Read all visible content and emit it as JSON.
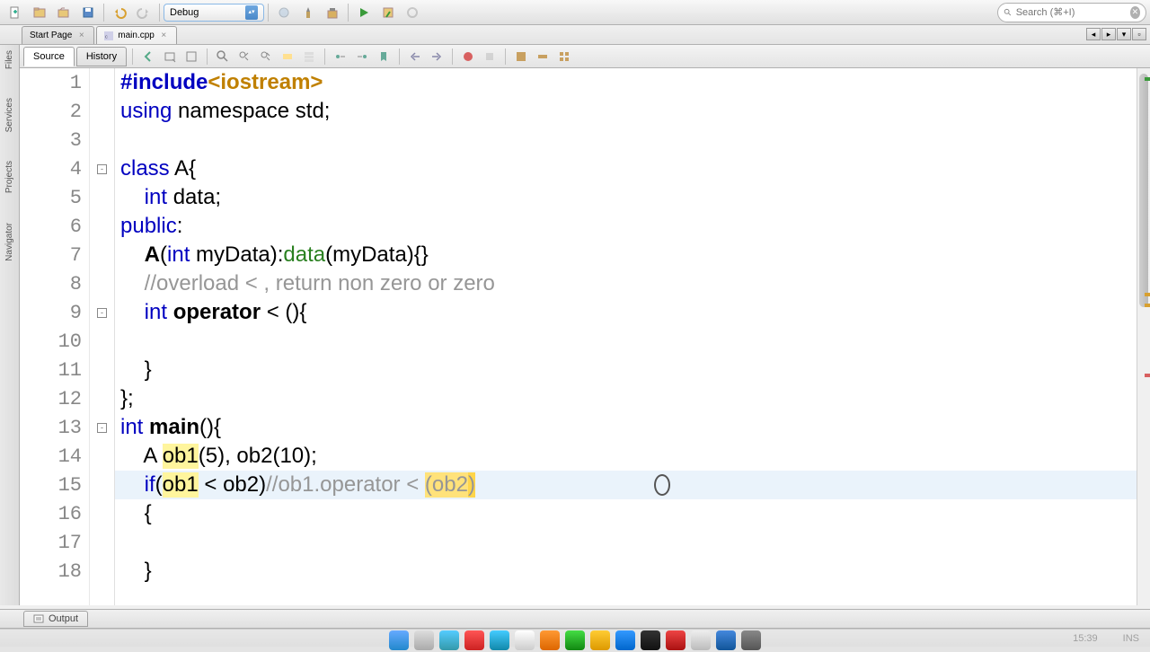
{
  "toolbar": {
    "config": "Debug",
    "search_placeholder": "Search (⌘+I)"
  },
  "tabs": {
    "start": "Start Page",
    "main": "main.cpp"
  },
  "editor_tabs": {
    "source": "Source",
    "history": "History"
  },
  "rail": {
    "files": "Files",
    "services": "Services",
    "projects": "Projects",
    "navigator": "Navigator"
  },
  "code": {
    "lines": [
      {
        "n": 1
      },
      {
        "n": 2
      },
      {
        "n": 3
      },
      {
        "n": 4,
        "fold": "-"
      },
      {
        "n": 5
      },
      {
        "n": 6
      },
      {
        "n": 7
      },
      {
        "n": 8
      },
      {
        "n": 9,
        "fold": "-"
      },
      {
        "n": 10
      },
      {
        "n": 11
      },
      {
        "n": 12
      },
      {
        "n": 13,
        "fold": "-"
      },
      {
        "n": 14
      },
      {
        "n": 15
      },
      {
        "n": 16
      },
      {
        "n": 17
      },
      {
        "n": 18
      }
    ],
    "l1_a": "#include",
    "l1_b": "<iostream>",
    "l2_a": "using",
    "l2_b": " namespace std;",
    "l4_a": "class",
    "l4_b": " A{",
    "l5_a": "    ",
    "l5_b": "int",
    "l5_c": " data;",
    "l6_a": "public",
    "l6_b": ":",
    "l7_a": "    ",
    "l7_b": "A",
    "l7_c": "(",
    "l7_d": "int",
    "l7_e": " myData):",
    "l7_f": "data",
    "l7_g": "(myData){}",
    "l8_a": "    ",
    "l8_b": "//overload < , return non zero or zero",
    "l9_a": "    ",
    "l9_b": "int",
    "l9_c": " ",
    "l9_d": "operator",
    "l9_e": " < (){",
    "l10_a": "        ",
    "l11_a": "    }",
    "l12_a": "};",
    "l13_a": "int",
    "l13_b": " ",
    "l13_c": "main",
    "l13_d": "(){",
    "l14_a": "    A ",
    "l14_b": "ob1",
    "l14_c": "(5), ob2(10);",
    "l15_a": "    ",
    "l15_b": "if",
    "l15_c": "(",
    "l15_d": "ob1",
    "l15_e": " < ob2)",
    "l15_f": "//ob1.operator < ",
    "l15_g": "(",
    "l15_h": "ob2",
    "l15_i": ")",
    "l16_a": "    {",
    "l17_a": "        ",
    "l18_a": "    }"
  },
  "bottom": {
    "output": "Output"
  },
  "status": {
    "pos": "15:39",
    "mode": "INS"
  }
}
